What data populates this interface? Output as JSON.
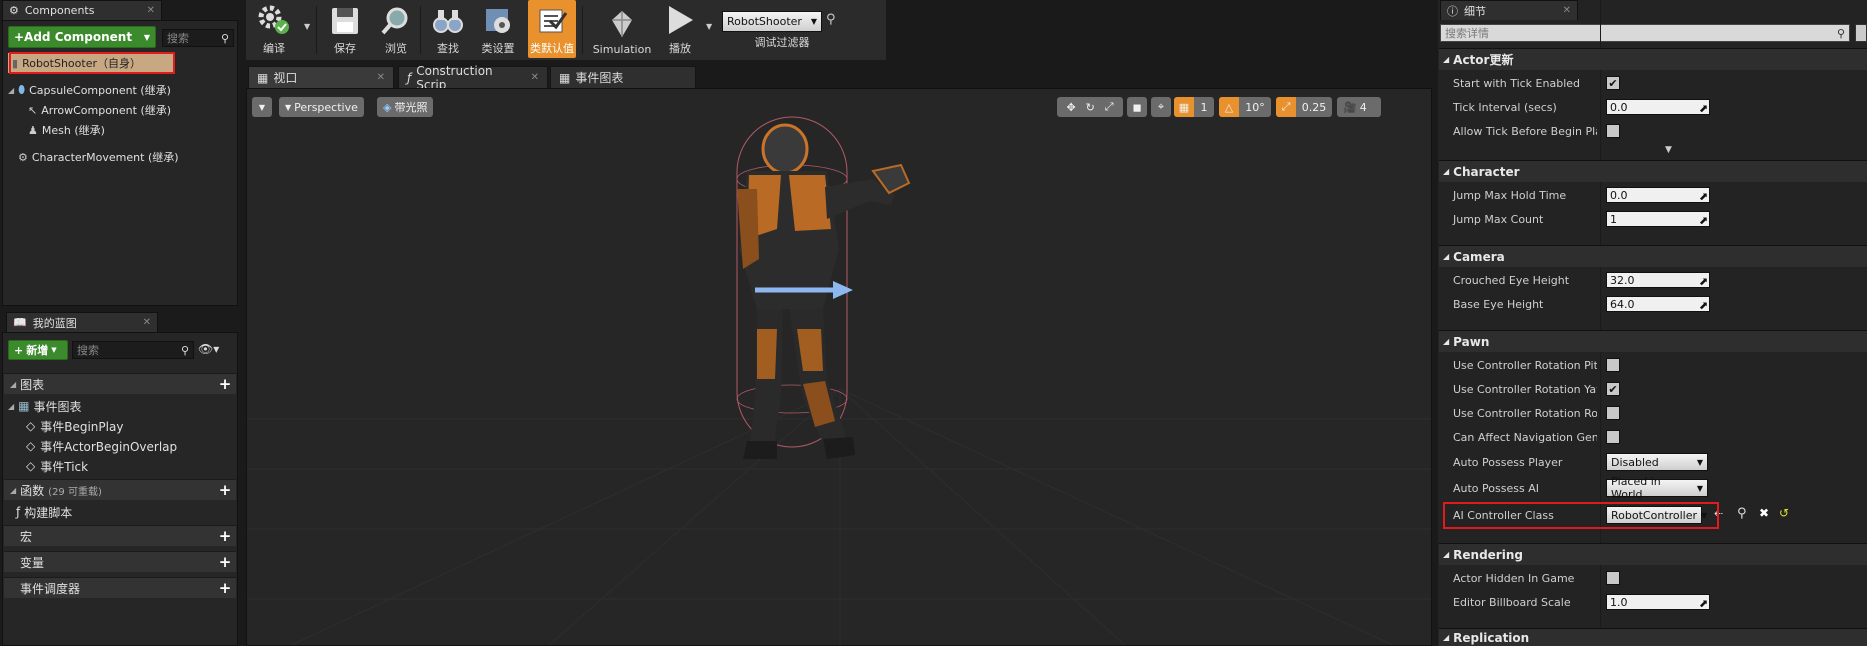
{
  "components_panel": {
    "tab_title": "Components",
    "add_button": "+Add Component",
    "search_placeholder": "搜索",
    "items": [
      {
        "label": "RobotShooter（自身）"
      },
      {
        "label": "CapsuleComponent (继承)"
      },
      {
        "label": "ArrowComponent (继承)"
      },
      {
        "label": "Mesh (继承)"
      },
      {
        "label": "CharacterMovement (继承)"
      }
    ]
  },
  "blueprint_panel": {
    "tab_title": "我的蓝图",
    "new_button": "新增",
    "search_placeholder": "搜索",
    "sections": {
      "graphs": "图表",
      "event_graph": "事件图表",
      "events": [
        "事件BeginPlay",
        "事件ActorBeginOverlap",
        "事件Tick"
      ],
      "functions": "函数",
      "functions_count": "(29 可重载)",
      "construction_script": "构建脚本",
      "macros": "宏",
      "variables": "变量",
      "event_dispatchers": "事件调度器"
    }
  },
  "toolbar": {
    "compile": "编译",
    "save": "保存",
    "browse": "浏览",
    "find": "查找",
    "class_settings": "类设置",
    "class_defaults": "类默认值",
    "simulation": "Simulation",
    "play": "播放",
    "debug_object": "RobotShooter",
    "debug_filter": "调试过滤器"
  },
  "tabs": [
    {
      "label": "视口"
    },
    {
      "label": "Construction Scrip"
    },
    {
      "label": "事件图表"
    }
  ],
  "viewport": {
    "perspective": "Perspective",
    "lit": "带光照",
    "grid_snap": "1",
    "rotation_snap": "10°",
    "scale_snap": "0.25",
    "camera_speed": "4"
  },
  "details": {
    "tab_title": "细节",
    "search_placeholder": "搜索详情",
    "sections": {
      "actor_tick": "Actor更新",
      "character": "Character",
      "camera": "Camera",
      "pawn": "Pawn",
      "rendering": "Rendering",
      "replication": "Replication"
    },
    "props": {
      "start_with_tick": {
        "label": "Start with Tick Enabled",
        "checked": true
      },
      "tick_interval": {
        "label": "Tick Interval (secs)",
        "value": "0.0"
      },
      "allow_tick_before_play": {
        "label": "Allow Tick Before Begin Play",
        "checked": false
      },
      "jump_max_hold": {
        "label": "Jump Max Hold Time",
        "value": "0.0"
      },
      "jump_max_count": {
        "label": "Jump Max Count",
        "value": "1"
      },
      "crouched_eye": {
        "label": "Crouched Eye Height",
        "value": "32.0"
      },
      "base_eye": {
        "label": "Base Eye Height",
        "value": "64.0"
      },
      "use_rot_pitch": {
        "label": "Use Controller Rotation Pitch",
        "checked": false
      },
      "use_rot_yaw": {
        "label": "Use Controller Rotation Yaw",
        "checked": true
      },
      "use_rot_roll": {
        "label": "Use Controller Rotation Roll",
        "checked": false
      },
      "can_affect_nav": {
        "label": "Can Affect Navigation Genera",
        "checked": false
      },
      "auto_possess_player": {
        "label": "Auto Possess Player",
        "value": "Disabled"
      },
      "auto_possess_ai": {
        "label": "Auto Possess AI",
        "value": "Placed in World"
      },
      "ai_controller_class": {
        "label": "AI Controller Class",
        "value": "RobotController"
      },
      "actor_hidden": {
        "label": "Actor Hidden In Game",
        "checked": false
      },
      "billboard_scale": {
        "label": "Editor Billboard Scale",
        "value": "1.0"
      }
    }
  },
  "colors": {
    "accent_orange": "#e8912d",
    "highlight_red": "#e01b1b",
    "green_button": "#3b8b2c"
  }
}
